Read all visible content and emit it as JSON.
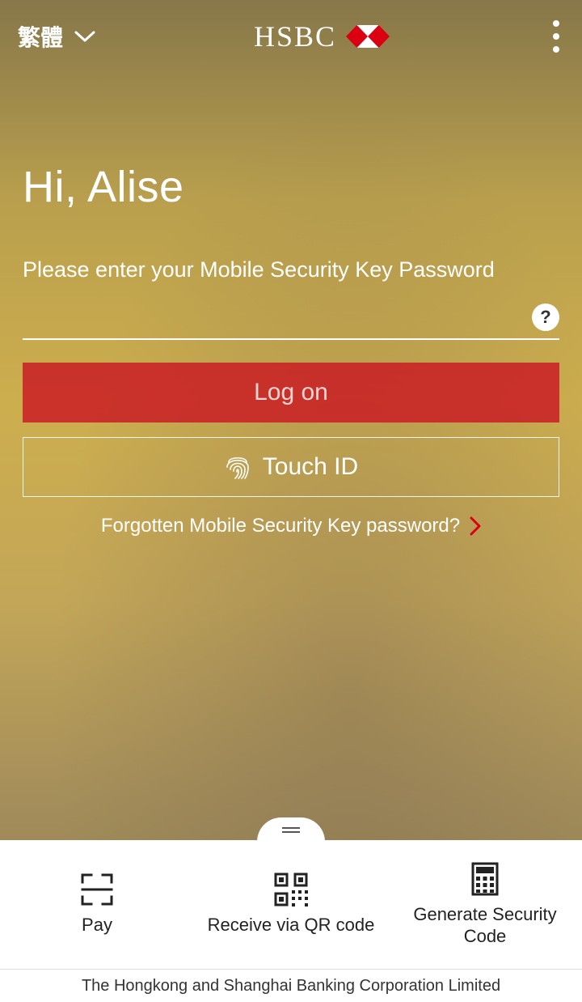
{
  "header": {
    "language_label": "繁體",
    "brand_name": "HSBC"
  },
  "greeting": "Hi, Alise",
  "subtitle": "Please enter your Mobile Security Key Password",
  "input": {
    "value": "",
    "placeholder": ""
  },
  "help_symbol": "?",
  "buttons": {
    "logon": "Log on",
    "touch_id": "Touch ID"
  },
  "forgot_label": "Forgotten Mobile Security Key password?",
  "bottom": {
    "items": [
      {
        "label": "Pay"
      },
      {
        "label": "Receive via QR code"
      },
      {
        "label": "Generate Security Code"
      }
    ]
  },
  "footer": "The Hongkong and Shanghai Banking Corporation Limited",
  "colors": {
    "brand_red": "#db0011"
  }
}
